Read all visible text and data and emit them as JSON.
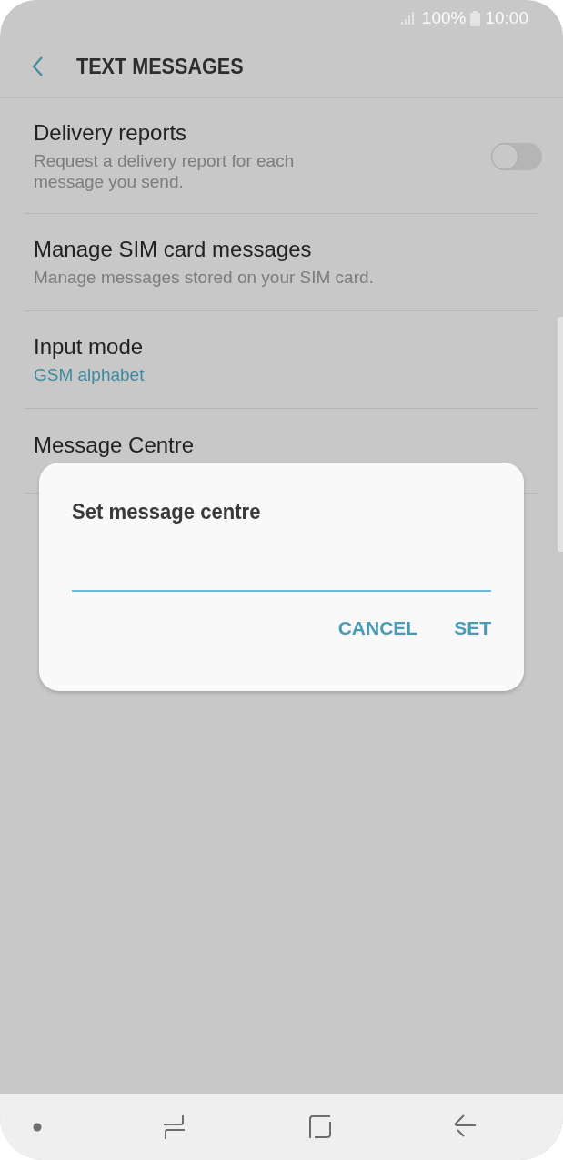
{
  "status_bar": {
    "battery": "100%",
    "time": "10:00"
  },
  "header": {
    "title": "TEXT MESSAGES"
  },
  "settings": [
    {
      "kind": "toggle",
      "title": "Delivery reports",
      "subtitle": "Request a delivery report for each message you send.",
      "on": false
    },
    {
      "kind": "plain",
      "title": "Manage SIM card messages",
      "subtitle": "Manage messages stored on your SIM card."
    },
    {
      "kind": "value",
      "title": "Input mode",
      "subtitle": "GSM alphabet"
    },
    {
      "kind": "plain",
      "title": "Message Centre"
    }
  ],
  "dialog": {
    "title": "Set message centre",
    "buttons": [
      "CANCEL",
      "SET"
    ]
  }
}
